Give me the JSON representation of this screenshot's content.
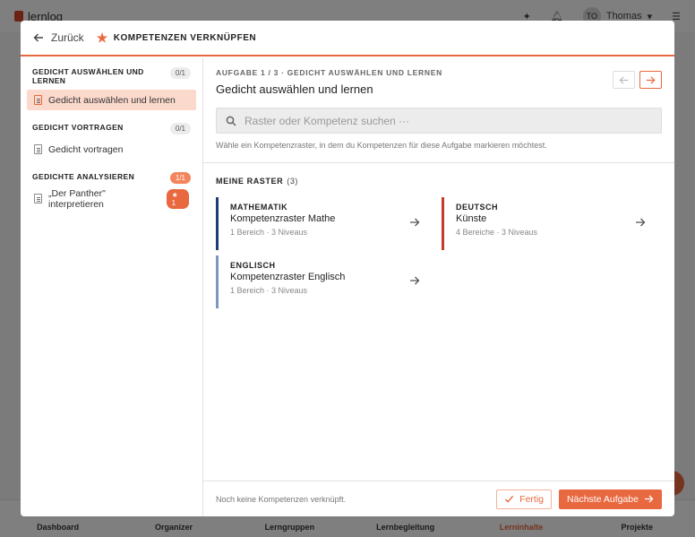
{
  "app": {
    "logo_text": "lernlog",
    "user_initials": "TO",
    "user_name": "Thomas",
    "tabs": [
      {
        "label": "Dashboard"
      },
      {
        "label": "Organizer"
      },
      {
        "label": "Lerngruppen"
      },
      {
        "label": "Lernbegleitung"
      },
      {
        "label": "Lerninhalte"
      },
      {
        "label": "Projekte"
      }
    ],
    "active_tab": "Lerninhalte"
  },
  "modal": {
    "back_label": "Zurück",
    "title": "KOMPETENZEN VERKNÜPFEN",
    "sidebar": {
      "sections": [
        {
          "title": "GEDICHT AUSWÄHLEN UND LERNEN",
          "count": "0/1",
          "items": [
            {
              "label": "Gedicht auswählen und lernen",
              "active": true
            }
          ]
        },
        {
          "title": "GEDICHT VORTRAGEN",
          "count": "0/1",
          "items": [
            {
              "label": "Gedicht vortragen",
              "active": false
            }
          ]
        },
        {
          "title": "GEDICHTE ANALYSIEREN",
          "count": "1/1",
          "items": [
            {
              "label": "„Der Panther\" interpretieren",
              "active": false,
              "badge": "★ 1"
            }
          ]
        }
      ]
    },
    "main": {
      "breadcrumb": "AUFGABE 1 / 3 · GEDICHT AUSWÄHLEN UND LERNEN",
      "task_title": "Gedicht auswählen und lernen",
      "search_placeholder": "Raster oder Kompetenz suchen ···",
      "hint": "Wähle ein Kompetenzraster, in dem du Kompetenzen für diese Aufgabe markieren möchtest.",
      "raster_heading": "MEINE RASTER",
      "raster_count": "(3)",
      "rasters": [
        {
          "subject": "MATHEMATIK",
          "name": "Kompetenzraster Mathe",
          "meta": "1 Bereich · 3 Niveaus",
          "color": "#1a3f73"
        },
        {
          "subject": "DEUTSCH",
          "name": "Künste",
          "meta": "4 Bereiche · 3 Niveaus",
          "color": "#c8392b"
        },
        {
          "subject": "ENGLISCH",
          "name": "Kompetenzraster Englisch",
          "meta": "1 Bereich · 3 Niveaus",
          "color": "#7b98bf"
        }
      ]
    },
    "footer": {
      "note": "Noch keine Kompetenzen verknüpft.",
      "done_label": "Fertig",
      "next_label": "Nächste Aufgabe"
    }
  },
  "colors": {
    "accent": "#e8683f"
  }
}
